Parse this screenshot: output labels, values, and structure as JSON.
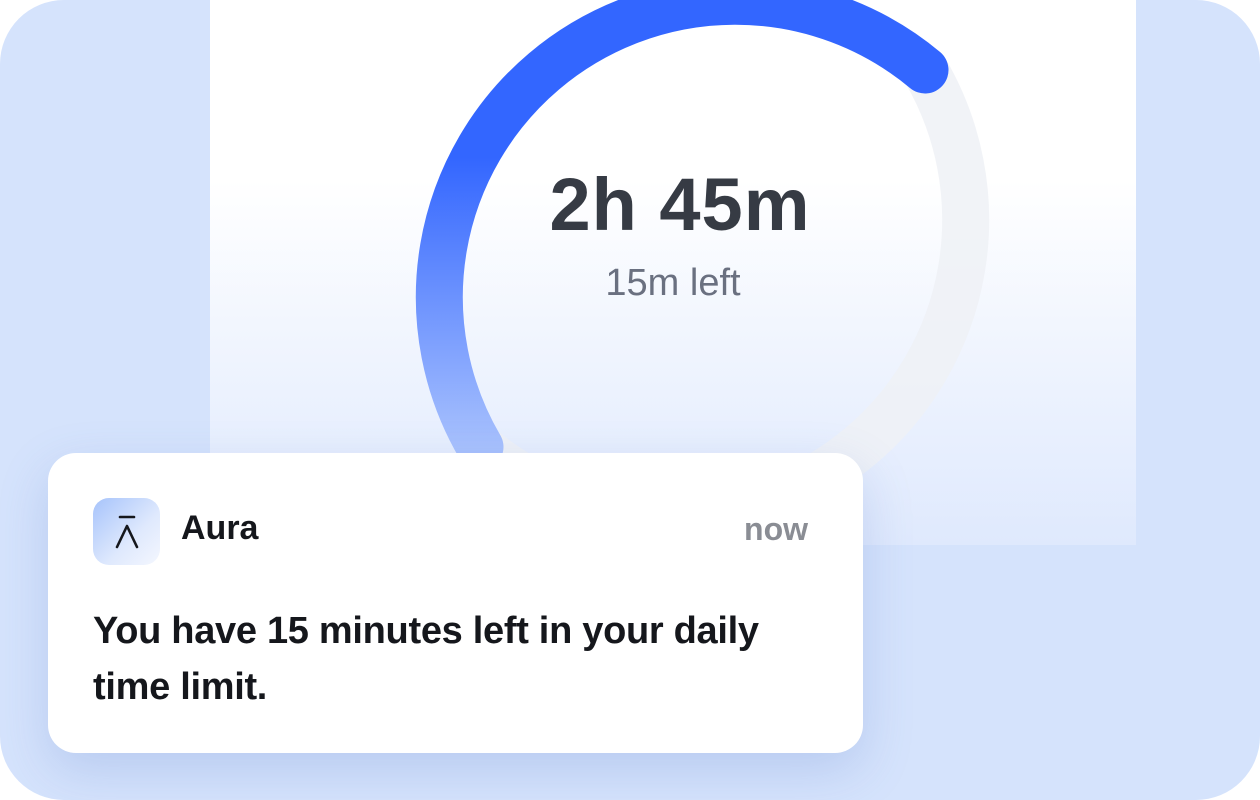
{
  "timer": {
    "time_used": "2h 45m",
    "time_left": "15m left",
    "progress_fraction": 0.625
  },
  "notification": {
    "app_name": "Aura",
    "time": "now",
    "message": "You have 15 minutes left in your daily time limit."
  },
  "icons": {
    "app_icon": "aura-logo-icon"
  },
  "colors": {
    "frame_background": "#d5e3fc",
    "ring_active_top": "#3366ff",
    "ring_active_bottom": "#a8c1fd",
    "ring_track": "#eef1f6",
    "primary_text": "#15171c",
    "secondary_text": "#8a8d94"
  }
}
